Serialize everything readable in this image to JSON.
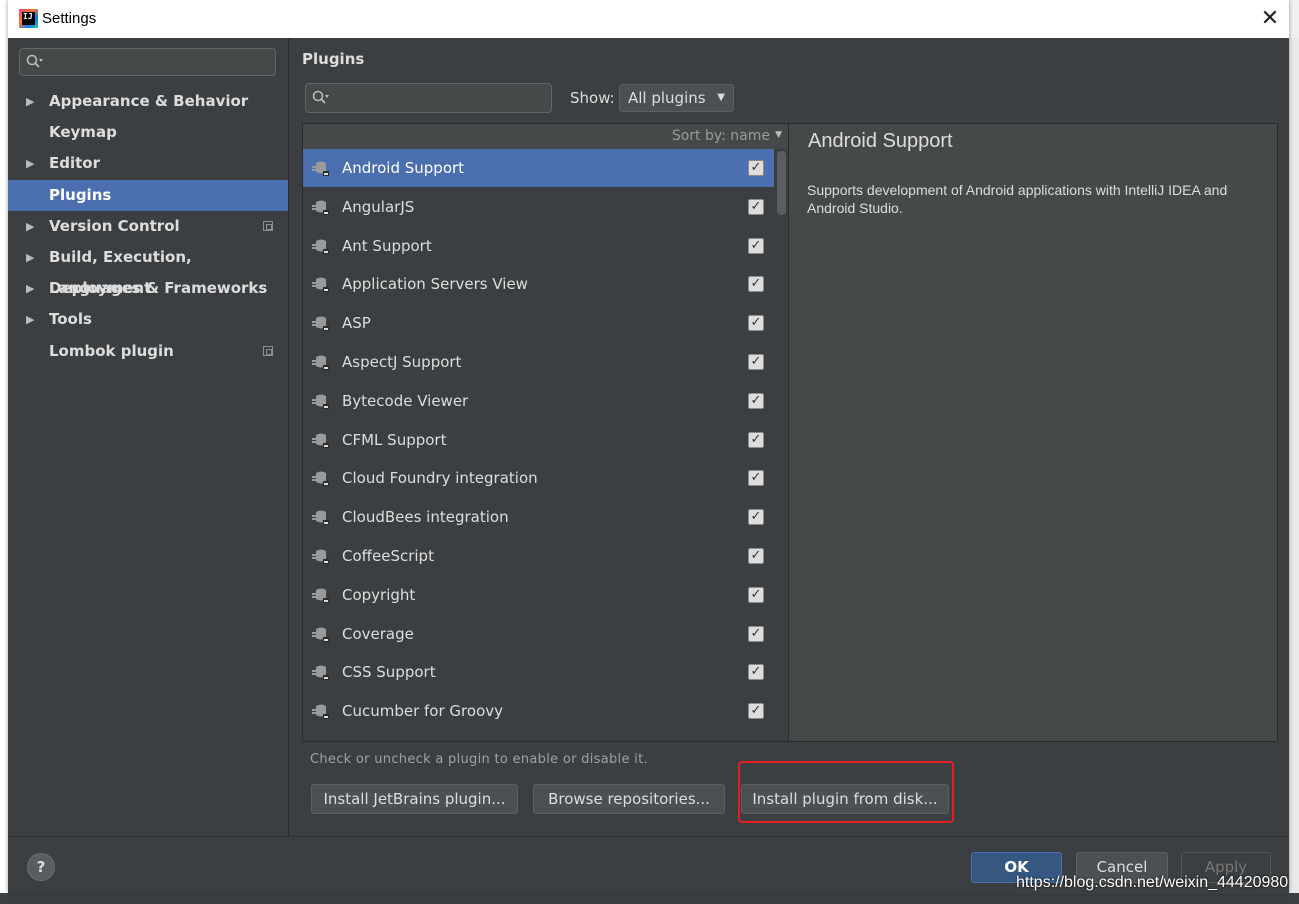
{
  "window": {
    "title": "Settings",
    "close_glyph": "✕"
  },
  "nav": {
    "items": [
      {
        "label": "Appearance & Behavior",
        "has_arrow": true
      },
      {
        "label": "Keymap",
        "has_arrow": false
      },
      {
        "label": "Editor",
        "has_arrow": true
      },
      {
        "label": "Plugins",
        "has_arrow": false,
        "selected": true
      },
      {
        "label": "Version Control",
        "has_arrow": true,
        "project_icon": true
      },
      {
        "label": "Build, Execution, Deployment",
        "has_arrow": true
      },
      {
        "label": "Languages & Frameworks",
        "has_arrow": true
      },
      {
        "label": "Tools",
        "has_arrow": true
      },
      {
        "label": "Lombok plugin",
        "has_arrow": false,
        "project_icon": true
      }
    ]
  },
  "plugins": {
    "title": "Plugins",
    "show_label": "Show:",
    "show_value": "All plugins",
    "sort_label": "Sort by: name",
    "list": [
      {
        "name": "Android Support",
        "checked": true,
        "selected": true
      },
      {
        "name": "AngularJS",
        "checked": true
      },
      {
        "name": "Ant Support",
        "checked": true
      },
      {
        "name": "Application Servers View",
        "checked": true
      },
      {
        "name": "ASP",
        "checked": true
      },
      {
        "name": "AspectJ Support",
        "checked": true
      },
      {
        "name": "Bytecode Viewer",
        "checked": true
      },
      {
        "name": "CFML Support",
        "checked": true
      },
      {
        "name": "Cloud Foundry integration",
        "checked": true
      },
      {
        "name": "CloudBees integration",
        "checked": true
      },
      {
        "name": "CoffeeScript",
        "checked": true
      },
      {
        "name": "Copyright",
        "checked": true
      },
      {
        "name": "Coverage",
        "checked": true
      },
      {
        "name": "CSS Support",
        "checked": true
      },
      {
        "name": "Cucumber for Groovy",
        "checked": true
      }
    ],
    "detail": {
      "title": "Android Support",
      "description": "Supports development of Android applications with IntelliJ IDEA and Android Studio."
    },
    "hint": "Check or uncheck a plugin to enable or disable it.",
    "buttons": {
      "install_jetbrains": "Install JetBrains plugin...",
      "browse_repos": "Browse repositories...",
      "install_disk": "Install plugin from disk..."
    }
  },
  "footer": {
    "help": "?",
    "ok": "OK",
    "cancel": "Cancel",
    "apply": "Apply"
  },
  "watermark": "https://blog.csdn.net/weixin_44420980",
  "colors": {
    "selection": "#4b6eaf",
    "panel": "#3c3f41",
    "highlight": "#e41e1e"
  }
}
